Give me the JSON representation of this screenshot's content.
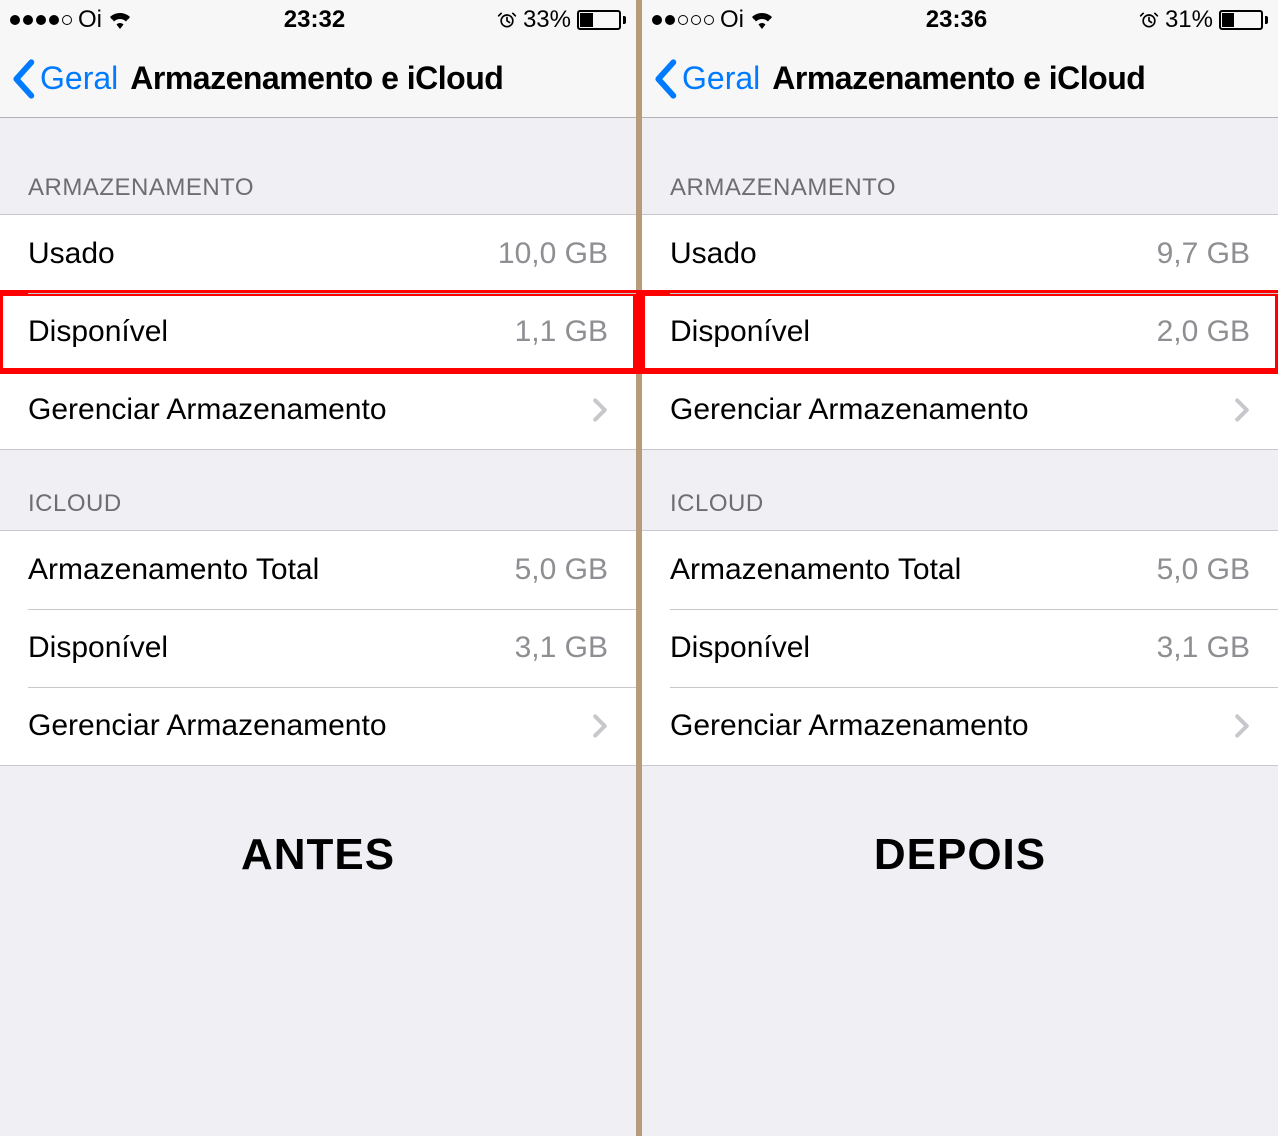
{
  "left": {
    "status": {
      "carrier": "Oi",
      "time": "23:32",
      "battery_pct": "33%",
      "signal_filled": 4,
      "signal_total": 5,
      "battery_fill_pct": 33
    },
    "nav": {
      "back": "Geral",
      "title": "Armazenamento e iCloud"
    },
    "storage": {
      "header": "ARMAZENAMENTO",
      "used_label": "Usado",
      "used_value": "10,0 GB",
      "available_label": "Disponível",
      "available_value": "1,1 GB",
      "manage_label": "Gerenciar Armazenamento"
    },
    "icloud": {
      "header": "ICLOUD",
      "total_label": "Armazenamento Total",
      "total_value": "5,0 GB",
      "available_label": "Disponível",
      "available_value": "3,1 GB",
      "manage_label": "Gerenciar Armazenamento"
    },
    "caption": "ANTES"
  },
  "right": {
    "status": {
      "carrier": "Oi",
      "time": "23:36",
      "battery_pct": "31%",
      "signal_filled": 2,
      "signal_total": 5,
      "battery_fill_pct": 31
    },
    "nav": {
      "back": "Geral",
      "title": "Armazenamento e iCloud"
    },
    "storage": {
      "header": "ARMAZENAMENTO",
      "used_label": "Usado",
      "used_value": "9,7 GB",
      "available_label": "Disponível",
      "available_value": "2,0 GB",
      "manage_label": "Gerenciar Armazenamento"
    },
    "icloud": {
      "header": "ICLOUD",
      "total_label": "Armazenamento Total",
      "total_value": "5,0 GB",
      "available_label": "Disponível",
      "available_value": "3,1 GB",
      "manage_label": "Gerenciar Armazenamento"
    },
    "caption": "DEPOIS"
  }
}
